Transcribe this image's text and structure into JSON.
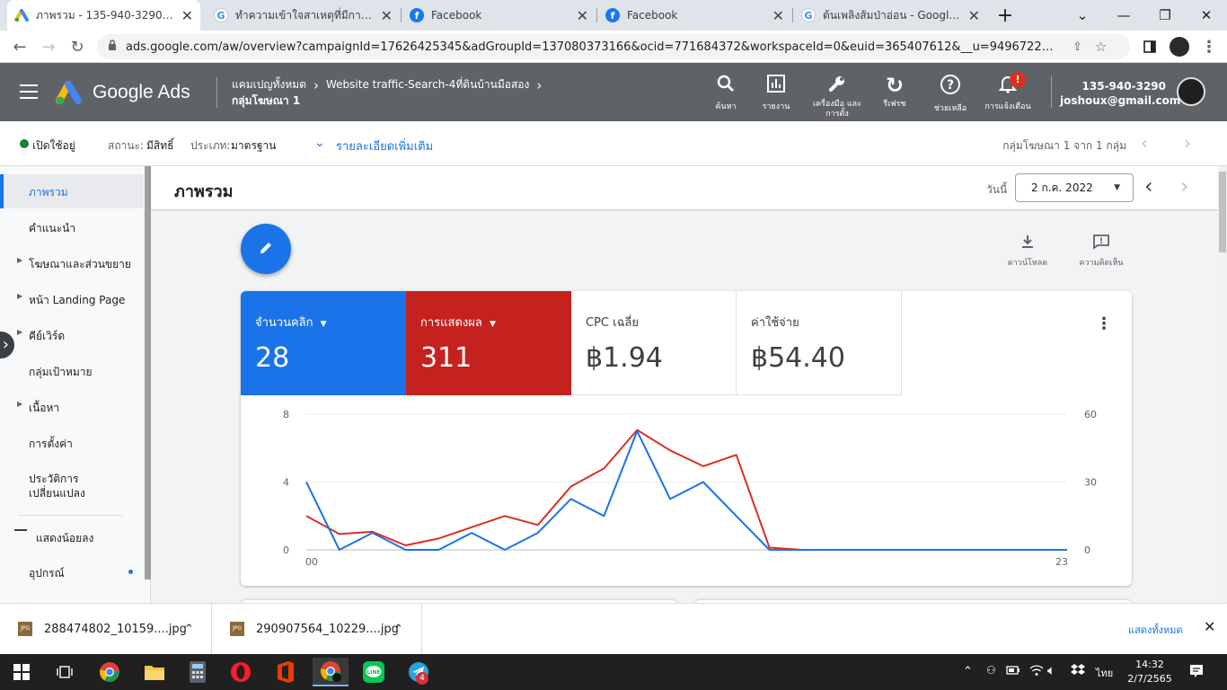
{
  "browser": {
    "tabs": [
      {
        "title": "ภาพรวม - 135-940-3290 - Goo",
        "favicon": "google-ads-icon",
        "active": true
      },
      {
        "title": "ทำความเข้าใจสาเหตุที่มีการเรียกเก็",
        "favicon": "google-icon",
        "active": false
      },
      {
        "title": "Facebook",
        "favicon": "facebook-icon",
        "active": false
      },
      {
        "title": "Facebook",
        "favicon": "facebook-icon",
        "active": false
      },
      {
        "title": "ต้นเพลิงส้มป่าอ่อน - Google Sea",
        "favicon": "google-icon",
        "active": false
      }
    ],
    "url": "ads.google.com/aw/overview?campaignId=17626425345&adGroupId=137080373166&ocid=771684372&workspaceId=0&euid=365407612&__u=9496722588&uscid=..."
  },
  "header": {
    "product": "Google Ads",
    "breadcrumb_top": "แคมเปญทั้งหมด",
    "campaign": "Website traffic-Search-4ที่ดินบ้านมือสอง",
    "adgroup": "กลุ่มโฆษณา 1",
    "tools": [
      {
        "label": "ค้นหา",
        "icon": "search-icon"
      },
      {
        "label": "รายงาน",
        "icon": "reports-icon"
      },
      {
        "label": "เครื่องมือ และการตั้ง",
        "icon": "wrench-icon"
      },
      {
        "label": "รีเฟรช",
        "icon": "refresh-icon"
      },
      {
        "label": "ช่วยเหลือ",
        "icon": "help-icon"
      },
      {
        "label": "การแจ้งเตือน",
        "icon": "bell-icon"
      }
    ],
    "notification_badge": "!",
    "account_id": "135-940-3290",
    "email": "joshoux@gmail.com"
  },
  "subheader": {
    "status_on": "เปิดใช้อยู่",
    "status_label": "สถานะ:",
    "status_value": "มีสิทธิ์",
    "type_label": "ประเภท:",
    "type_value": "มาตรฐาน",
    "more_details": "รายละเอียดเพิ่มเติม",
    "pager": "กลุ่มโฆษณา 1 จาก 1 กลุ่ม"
  },
  "sidebar": {
    "items": [
      {
        "label": "ภาพรวม",
        "expandable": false
      },
      {
        "label": "คำแนะนำ",
        "expandable": false
      },
      {
        "label": "โฆษณาและส่วนขยาย",
        "expandable": true
      },
      {
        "label": "หน้า Landing Page",
        "expandable": true
      },
      {
        "label": "คีย์เวิร์ด",
        "expandable": true
      },
      {
        "label": "กลุ่มเป้าหมาย",
        "expandable": false
      },
      {
        "label": "เนื้อหา",
        "expandable": true
      },
      {
        "label": "การตั้งค่า",
        "expandable": false
      }
    ],
    "history_line1": "ประวัติการ",
    "history_line2": "เปลี่ยนแปลง",
    "show_less": "แสดงน้อยลง",
    "devices": "อุปกรณ์"
  },
  "page": {
    "title": "ภาพรวม",
    "date_label": "วันนี้",
    "date_value": "2 ก.ค. 2022",
    "download": "ดาวน์โหลด",
    "feedback": "ความคิดเห็น"
  },
  "metrics": [
    {
      "label": "จำนวนคลิก",
      "value": "28",
      "color": "#1a73e8",
      "dropdown": true
    },
    {
      "label": "การแสดงผล",
      "value": "311",
      "color": "#c5221f",
      "dropdown": true
    },
    {
      "label": "CPC เฉลี่ย",
      "value": "฿1.94",
      "color": "#ffffff",
      "dropdown": false
    },
    {
      "label": "ค่าใช้จ่าย",
      "value": "฿54.40",
      "color": "#ffffff",
      "dropdown": false
    }
  ],
  "chart_data": {
    "type": "line",
    "x_labels": [
      "00",
      "23"
    ],
    "x": [
      0,
      1,
      2,
      3,
      4,
      5,
      6,
      7,
      8,
      9,
      10,
      11,
      12,
      13,
      14,
      15,
      16,
      17,
      18,
      19,
      20,
      21,
      22,
      23
    ],
    "left_ticks": [
      0,
      4,
      8
    ],
    "right_ticks": [
      0,
      30,
      60
    ],
    "ylim_left": [
      0,
      8
    ],
    "ylim_right": [
      0,
      60
    ],
    "series": [
      {
        "color": "#1a73e8",
        "axis": "left",
        "values": [
          4,
          0,
          1,
          0,
          0,
          1,
          0,
          1,
          3,
          2,
          7,
          3,
          4,
          2,
          0,
          0,
          0,
          0,
          0,
          0,
          0,
          0,
          0,
          0
        ]
      },
      {
        "color": "#d93025",
        "axis": "right",
        "values": [
          15,
          7,
          8,
          2,
          5,
          10,
          15,
          11,
          28,
          36,
          53,
          44,
          37,
          42,
          1,
          0,
          0,
          0,
          0,
          0,
          0,
          0,
          0,
          0
        ]
      }
    ]
  },
  "downloads": {
    "files": [
      "288474802_10159....jpg",
      "290907564_10229....jpg"
    ],
    "show_all": "แสดงทั้งหมด"
  },
  "taskbar": {
    "language": "ไทย",
    "time": "14:32",
    "date": "2/7/2565",
    "telegram_badge": "4"
  }
}
